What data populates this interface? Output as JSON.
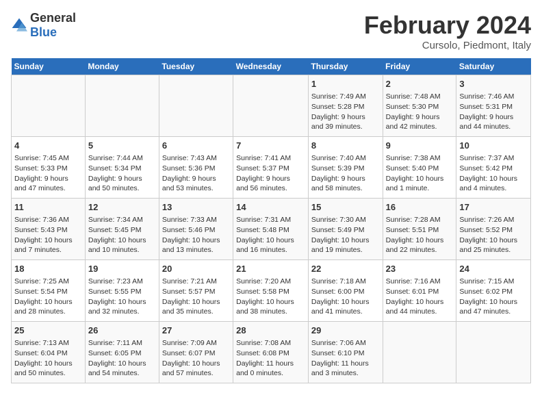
{
  "logo": {
    "general": "General",
    "blue": "Blue"
  },
  "title": "February 2024",
  "subtitle": "Cursolo, Piedmont, Italy",
  "headers": [
    "Sunday",
    "Monday",
    "Tuesday",
    "Wednesday",
    "Thursday",
    "Friday",
    "Saturday"
  ],
  "weeks": [
    [
      {
        "day": "",
        "info": ""
      },
      {
        "day": "",
        "info": ""
      },
      {
        "day": "",
        "info": ""
      },
      {
        "day": "",
        "info": ""
      },
      {
        "day": "1",
        "info": "Sunrise: 7:49 AM\nSunset: 5:28 PM\nDaylight: 9 hours\nand 39 minutes."
      },
      {
        "day": "2",
        "info": "Sunrise: 7:48 AM\nSunset: 5:30 PM\nDaylight: 9 hours\nand 42 minutes."
      },
      {
        "day": "3",
        "info": "Sunrise: 7:46 AM\nSunset: 5:31 PM\nDaylight: 9 hours\nand 44 minutes."
      }
    ],
    [
      {
        "day": "4",
        "info": "Sunrise: 7:45 AM\nSunset: 5:33 PM\nDaylight: 9 hours\nand 47 minutes."
      },
      {
        "day": "5",
        "info": "Sunrise: 7:44 AM\nSunset: 5:34 PM\nDaylight: 9 hours\nand 50 minutes."
      },
      {
        "day": "6",
        "info": "Sunrise: 7:43 AM\nSunset: 5:36 PM\nDaylight: 9 hours\nand 53 minutes."
      },
      {
        "day": "7",
        "info": "Sunrise: 7:41 AM\nSunset: 5:37 PM\nDaylight: 9 hours\nand 56 minutes."
      },
      {
        "day": "8",
        "info": "Sunrise: 7:40 AM\nSunset: 5:39 PM\nDaylight: 9 hours\nand 58 minutes."
      },
      {
        "day": "9",
        "info": "Sunrise: 7:38 AM\nSunset: 5:40 PM\nDaylight: 10 hours\nand 1 minute."
      },
      {
        "day": "10",
        "info": "Sunrise: 7:37 AM\nSunset: 5:42 PM\nDaylight: 10 hours\nand 4 minutes."
      }
    ],
    [
      {
        "day": "11",
        "info": "Sunrise: 7:36 AM\nSunset: 5:43 PM\nDaylight: 10 hours\nand 7 minutes."
      },
      {
        "day": "12",
        "info": "Sunrise: 7:34 AM\nSunset: 5:45 PM\nDaylight: 10 hours\nand 10 minutes."
      },
      {
        "day": "13",
        "info": "Sunrise: 7:33 AM\nSunset: 5:46 PM\nDaylight: 10 hours\nand 13 minutes."
      },
      {
        "day": "14",
        "info": "Sunrise: 7:31 AM\nSunset: 5:48 PM\nDaylight: 10 hours\nand 16 minutes."
      },
      {
        "day": "15",
        "info": "Sunrise: 7:30 AM\nSunset: 5:49 PM\nDaylight: 10 hours\nand 19 minutes."
      },
      {
        "day": "16",
        "info": "Sunrise: 7:28 AM\nSunset: 5:51 PM\nDaylight: 10 hours\nand 22 minutes."
      },
      {
        "day": "17",
        "info": "Sunrise: 7:26 AM\nSunset: 5:52 PM\nDaylight: 10 hours\nand 25 minutes."
      }
    ],
    [
      {
        "day": "18",
        "info": "Sunrise: 7:25 AM\nSunset: 5:54 PM\nDaylight: 10 hours\nand 28 minutes."
      },
      {
        "day": "19",
        "info": "Sunrise: 7:23 AM\nSunset: 5:55 PM\nDaylight: 10 hours\nand 32 minutes."
      },
      {
        "day": "20",
        "info": "Sunrise: 7:21 AM\nSunset: 5:57 PM\nDaylight: 10 hours\nand 35 minutes."
      },
      {
        "day": "21",
        "info": "Sunrise: 7:20 AM\nSunset: 5:58 PM\nDaylight: 10 hours\nand 38 minutes."
      },
      {
        "day": "22",
        "info": "Sunrise: 7:18 AM\nSunset: 6:00 PM\nDaylight: 10 hours\nand 41 minutes."
      },
      {
        "day": "23",
        "info": "Sunrise: 7:16 AM\nSunset: 6:01 PM\nDaylight: 10 hours\nand 44 minutes."
      },
      {
        "day": "24",
        "info": "Sunrise: 7:15 AM\nSunset: 6:02 PM\nDaylight: 10 hours\nand 47 minutes."
      }
    ],
    [
      {
        "day": "25",
        "info": "Sunrise: 7:13 AM\nSunset: 6:04 PM\nDaylight: 10 hours\nand 50 minutes."
      },
      {
        "day": "26",
        "info": "Sunrise: 7:11 AM\nSunset: 6:05 PM\nDaylight: 10 hours\nand 54 minutes."
      },
      {
        "day": "27",
        "info": "Sunrise: 7:09 AM\nSunset: 6:07 PM\nDaylight: 10 hours\nand 57 minutes."
      },
      {
        "day": "28",
        "info": "Sunrise: 7:08 AM\nSunset: 6:08 PM\nDaylight: 11 hours\nand 0 minutes."
      },
      {
        "day": "29",
        "info": "Sunrise: 7:06 AM\nSunset: 6:10 PM\nDaylight: 11 hours\nand 3 minutes."
      },
      {
        "day": "",
        "info": ""
      },
      {
        "day": "",
        "info": ""
      }
    ]
  ]
}
